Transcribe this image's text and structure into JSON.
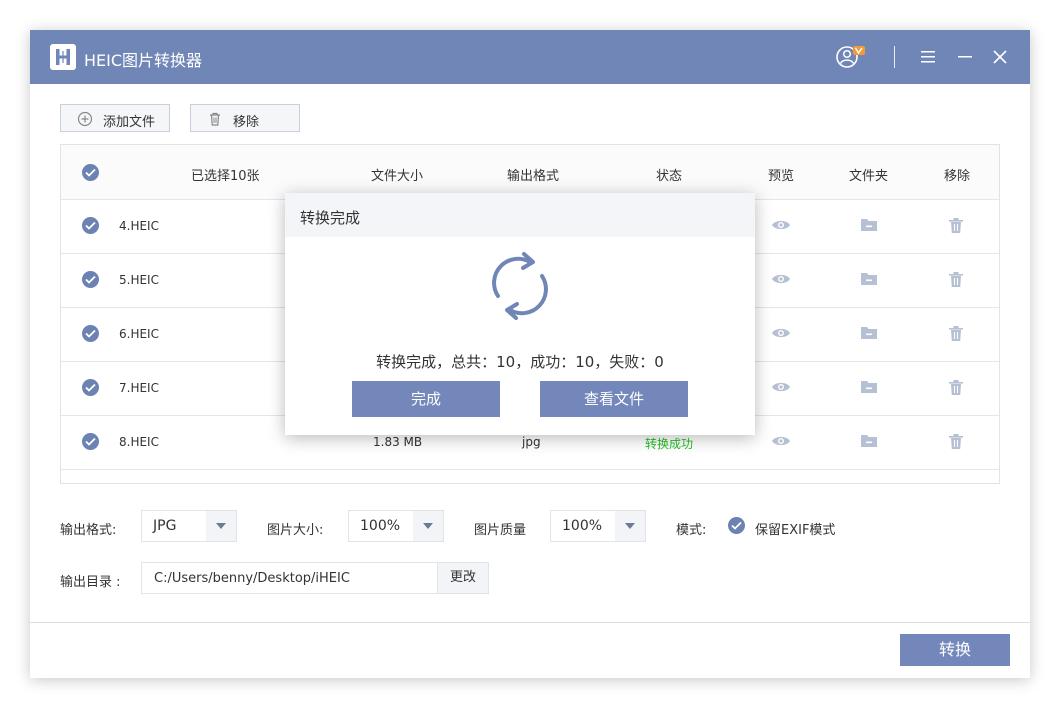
{
  "titlebar": {
    "app_title": "HEIC图片转换器",
    "icons": [
      "heic-logo-icon",
      "user-vip-icon",
      "menu-icon",
      "minimize-icon",
      "close-icon"
    ]
  },
  "toolbar": {
    "add_label": "添加文件",
    "remove_label": "移除"
  },
  "table": {
    "headers": {
      "selected": "已选择10张",
      "size": "文件大小",
      "format": "输出格式",
      "status": "状态",
      "preview": "预览",
      "folder": "文件夹",
      "remove": "移除"
    },
    "rows": [
      {
        "name": "4.HEIC",
        "size": "",
        "format": "",
        "status": ""
      },
      {
        "name": "5.HEIC",
        "size": "",
        "format": "",
        "status": ""
      },
      {
        "name": "6.HEIC",
        "size": "",
        "format": "",
        "status": ""
      },
      {
        "name": "7.HEIC",
        "size": "",
        "format": "",
        "status": ""
      },
      {
        "name": "8.HEIC",
        "size": "1.83 MB",
        "format": "jpg",
        "status": "转换成功"
      }
    ]
  },
  "settings": {
    "format_label": "输出格式:",
    "format_value": "JPG",
    "size_label": "图片大小:",
    "size_value": "100%",
    "quality_label": "图片质量",
    "quality_value": "100%",
    "mode_label": "模式:",
    "exif_label": "保留EXIF模式",
    "output_label": "输出目录 :",
    "output_path": "C:/Users/benny/Desktop/iHEIC",
    "change_label": "更改"
  },
  "convert_label": "转换",
  "modal": {
    "title": "转换完成",
    "message": "转换完成，总共：10，成功：10，失败：0",
    "done_label": "完成",
    "view_label": "查看文件"
  },
  "colors": {
    "accent": "#7086b6",
    "button": "#7387ba",
    "success": "#26c026"
  }
}
